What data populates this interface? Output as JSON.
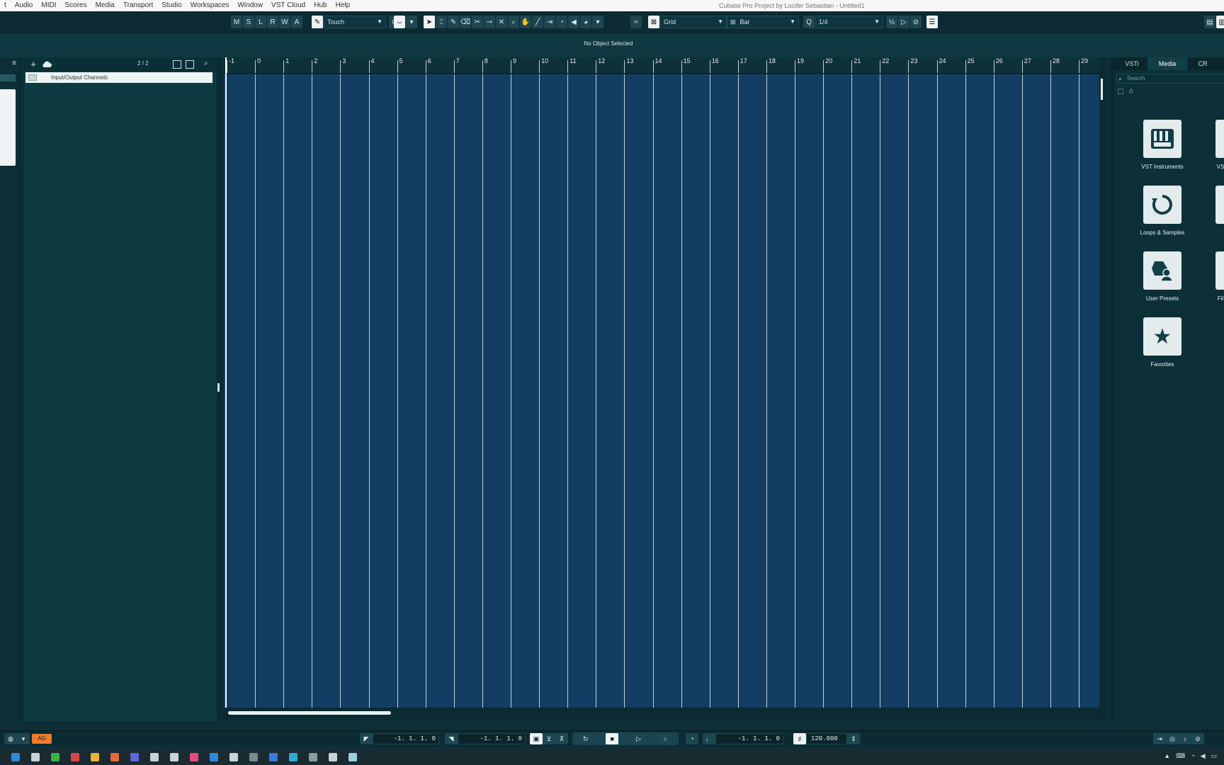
{
  "menu": {
    "items": [
      "t",
      "Audio",
      "MIDI",
      "Scores",
      "Media",
      "Transport",
      "Studio",
      "Workspaces",
      "Window",
      "VST Cloud",
      "Hub",
      "Help"
    ],
    "window_title": "Cubase Pro Project by Lucifer Sebastian - Untitled1"
  },
  "toolbar": {
    "state_buttons": [
      "M",
      "S",
      "L",
      "R",
      "W",
      "A"
    ],
    "automation_mode": "Touch",
    "snap_type": "Grid",
    "grid_type": "Bar",
    "quantize": "1/4"
  },
  "info_line": {
    "status": "No Object Selected"
  },
  "left_zone": {
    "menu_glyph": "≡"
  },
  "track_list": {
    "add_glyph": "+",
    "count": "2 / 2",
    "tracks": [
      {
        "name": "Input/Output Channels",
        "type": "folder"
      }
    ]
  },
  "ruler": {
    "bars": [
      "-1",
      "0",
      "1",
      "2",
      "3",
      "4",
      "5",
      "6",
      "7",
      "8",
      "9",
      "10",
      "11",
      "12",
      "13",
      "14",
      "15",
      "16",
      "17",
      "18",
      "19",
      "20",
      "21",
      "22",
      "23",
      "24",
      "25",
      "26",
      "27",
      "28",
      "29"
    ]
  },
  "right_zone": {
    "tabs": [
      "VSTi",
      "Media",
      "CR"
    ],
    "active_tab": "Media",
    "search_placeholder": "Search",
    "tiles": [
      {
        "label": "VST Instruments",
        "icon": "piano-keys-icon"
      },
      {
        "label": "Loops & Samples",
        "icon": "loop-icon"
      },
      {
        "label": "User Presets",
        "icon": "user-presets-icon"
      },
      {
        "label": "Favorites",
        "icon": "star-icon"
      }
    ],
    "clipped_labels": [
      "VS",
      "",
      "Fil",
      ""
    ]
  },
  "transport": {
    "ag_badge": "AG",
    "left_locator": "-1. 1. 1.   0",
    "right_locator": "-1. 1. 1.   0",
    "primary_time": "-1. 1. 1.   0",
    "tempo": "120.000"
  },
  "colors": {
    "accent_orange": "#f07b2a",
    "lane_blue": "#123e63",
    "panel_teal": "#0e3a42"
  }
}
